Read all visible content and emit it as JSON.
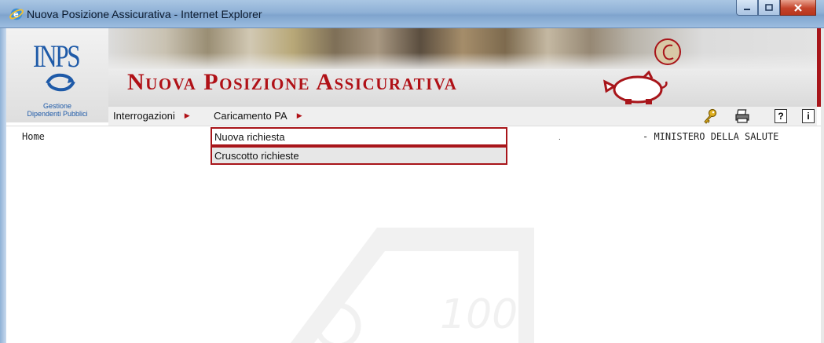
{
  "window": {
    "title": "Nuova Posizione Assicurativa - Internet Explorer",
    "controls": [
      "minimize",
      "maximize",
      "close"
    ]
  },
  "header": {
    "logo_text": "INPS",
    "logo_caption_line1": "Gestione",
    "logo_caption_line2": "Dipendenti Pubblici",
    "app_title": "Nuova Posizione Assicurativa",
    "accent_color": "#b01117"
  },
  "menu": {
    "items": [
      {
        "label": "Interrogazioni"
      },
      {
        "label": "Caricamento PA"
      }
    ],
    "dropdown": [
      {
        "label": "Nuova richiesta"
      },
      {
        "label": "Cruscotto richieste"
      }
    ],
    "toolbar_icons": [
      "key-icon",
      "printer-icon",
      "help-icon",
      "info-icon"
    ],
    "help_glyph": "?",
    "info_glyph": "i"
  },
  "content": {
    "breadcrumb": "Home",
    "separator": ".",
    "organization": "- MINISTERO DELLA SALUTE",
    "watermark_number": "100"
  }
}
